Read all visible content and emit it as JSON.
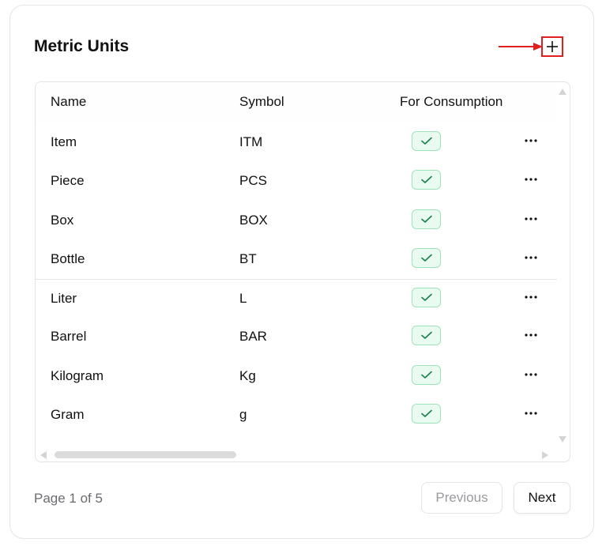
{
  "card": {
    "title": "Metric Units"
  },
  "colors": {
    "accent_red": "#e0201f",
    "check_bg": "#e9fbf0",
    "check_border": "#9fe3bb",
    "check_mark": "#1a7f4b",
    "muted_text": "#6b6b70"
  },
  "icons": {
    "add": "plus-icon",
    "pointer": "arrow-right-icon",
    "check": "check-icon",
    "row_menu": "ellipsis-icon"
  },
  "table": {
    "headers": {
      "name": "Name",
      "symbol": "Symbol",
      "consumption": "For Consumption"
    },
    "rows": [
      {
        "name": "Item",
        "symbol": "ITM",
        "for_consumption": true
      },
      {
        "name": "Piece",
        "symbol": "PCS",
        "for_consumption": true
      },
      {
        "name": "Box",
        "symbol": "BOX",
        "for_consumption": true
      },
      {
        "name": "Bottle",
        "symbol": "BT",
        "for_consumption": true
      },
      {
        "name": "Liter",
        "symbol": "L",
        "for_consumption": true
      },
      {
        "name": "Barrel",
        "symbol": "BAR",
        "for_consumption": true
      },
      {
        "name": "Kilogram",
        "symbol": "Kg",
        "for_consumption": true
      },
      {
        "name": "Gram",
        "symbol": "g",
        "for_consumption": true
      }
    ]
  },
  "pagination": {
    "info": "Page 1 of 5",
    "previous_label": "Previous",
    "next_label": "Next"
  }
}
